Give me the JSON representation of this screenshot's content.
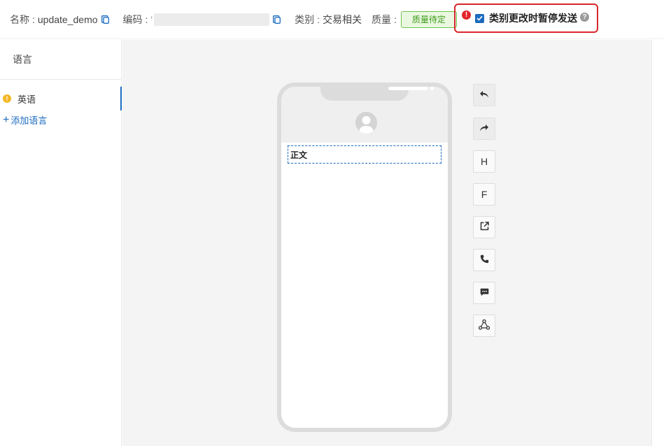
{
  "header": {
    "name_label": "名称",
    "name_value": "update_demo",
    "code_label": "编码",
    "code_value_prefix": "'",
    "category_label": "类别",
    "category_value": "交易相关",
    "quality_label": "质量",
    "quality_badge": "质量待定",
    "pause_checkbox_label": "类别更改时暂停发送",
    "pause_checked": true
  },
  "sidebar": {
    "title": "语言",
    "languages": [
      {
        "label": "英语",
        "status": "warning"
      }
    ],
    "add_language_label": "添加语言"
  },
  "preview": {
    "body_placeholder": "正文"
  },
  "toolbar": {
    "tools": [
      "undo-icon",
      "redo-icon",
      "header-icon",
      "footer-icon",
      "external-link-icon",
      "phone-icon",
      "message-icon",
      "share-icon"
    ],
    "header_label": "H",
    "footer_label": "F"
  },
  "colors": {
    "accent": "#1c6bbf",
    "highlight_border": "#d9262c",
    "badge_green": "#3f9c1a",
    "warning": "#f4b726"
  },
  "punct": {
    "colon": ":"
  }
}
